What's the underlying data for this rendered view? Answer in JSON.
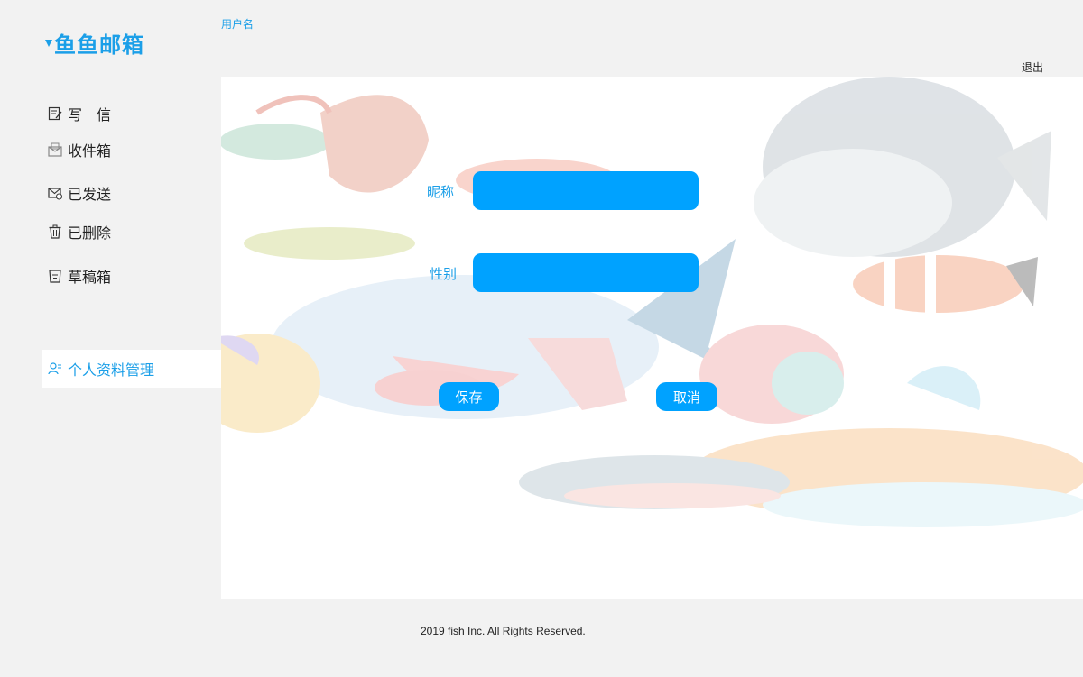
{
  "header": {
    "logo_text": "鱼鱼邮箱",
    "username": "用户名",
    "logout_label": "退出"
  },
  "sidebar": {
    "items": [
      {
        "label": "写　信",
        "icon": "compose-icon"
      },
      {
        "label": "收件箱",
        "icon": "inbox-icon"
      },
      {
        "label": "已发送",
        "icon": "sent-icon"
      },
      {
        "label": "已删除",
        "icon": "trash-icon"
      },
      {
        "label": "草稿箱",
        "icon": "drafts-icon"
      },
      {
        "label": "个人资料管理",
        "icon": "profile-icon",
        "active": true
      }
    ]
  },
  "form": {
    "nickname_label": "昵称",
    "nickname_value": "",
    "gender_label": "性别",
    "gender_value": "",
    "save_label": "保存",
    "cancel_label": "取消"
  },
  "footer": {
    "copyright": "2019 fish Inc. All Rights Reserved."
  },
  "colors": {
    "accent": "#00a2ff",
    "brand_text": "#1b9fe8",
    "panel_bg": "#f2f2f2"
  }
}
